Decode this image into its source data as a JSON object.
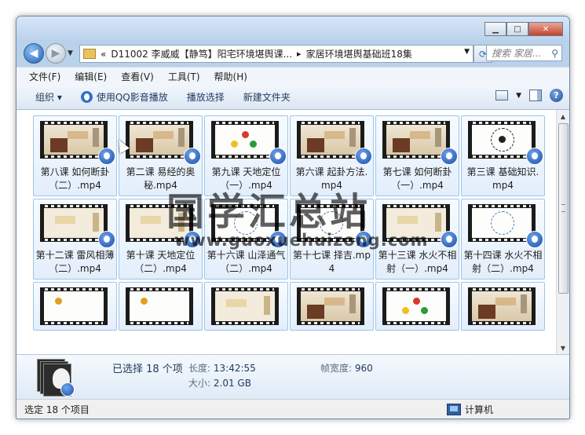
{
  "address": {
    "overflow_chevron": "«",
    "crumbs": [
      "D11002 李威威【静笃】阳宅环境堪舆课...",
      "家居环境堪舆基础班18集"
    ],
    "separator": "▸",
    "search_placeholder": "搜索 家居..."
  },
  "menu": [
    "文件(F)",
    "编辑(E)",
    "查看(V)",
    "工具(T)",
    "帮助(H)"
  ],
  "toolbar": {
    "organize": "组织 ▾",
    "play_qq": "使用QQ影音播放",
    "play_selection": "播放选择",
    "new_folder": "新建文件夹"
  },
  "files": [
    {
      "name": "第八课 如何断卦（二）.mp4",
      "thumb": "room"
    },
    {
      "name": "第二课 易经的奥秘.mp4",
      "thumb": "room"
    },
    {
      "name": "第九课 天地定位（一）.mp4",
      "thumb": "dots"
    },
    {
      "name": "第六课  起卦方法.mp4",
      "thumb": "room"
    },
    {
      "name": "第七课  如何断卦（一）.mp4",
      "thumb": "room"
    },
    {
      "name": "第三课 基础知识.mp4",
      "thumb": "bagua"
    },
    {
      "name": "第十二课 雷风相薄（二）.mp4",
      "thumb": "paper"
    },
    {
      "name": "第十课 天地定位（二）.mp4",
      "thumb": "paper"
    },
    {
      "name": "第十六课 山泽通气（二）.mp4",
      "thumb": "chart"
    },
    {
      "name": "第十七课  择吉.mp4",
      "thumb": "chart"
    },
    {
      "name": "第十三课 水火不相射（一）.mp4",
      "thumb": "paper"
    },
    {
      "name": "第十四课 水火不相射（二）.mp4",
      "thumb": "chart"
    }
  ],
  "partial_row_thumbs": [
    "white",
    "white",
    "paper",
    "room",
    "dots",
    "room"
  ],
  "details": {
    "selected": "已选择 18 个项",
    "length_label": "长度:",
    "length_value": "13:42:55",
    "size_label": "大小:",
    "size_value": "2.01 GB",
    "width_label": "帧宽度:",
    "width_value": "960"
  },
  "status": {
    "left": "选定 18 个项目",
    "right": "计算机"
  },
  "watermark": {
    "title": "国学汇总站",
    "url": "www.guoxuehuizong.com"
  },
  "colors": {
    "selection_border": "#9cc4ea",
    "frame_chrome": "#b9d1ea"
  }
}
